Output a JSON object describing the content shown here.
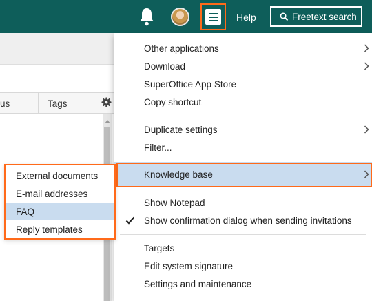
{
  "topbar": {
    "help_label": "Help",
    "search_label": "Freetext search",
    "icons": {
      "notifications": "bell-icon",
      "user": "avatar",
      "menu": "hamburger-menu-icon",
      "search": "search-icon"
    },
    "colors": {
      "bar": "#0e5e5a",
      "highlight": "#ff6a1a"
    }
  },
  "list": {
    "columns": [
      "us",
      "Tags"
    ],
    "settings_icon": "gear-icon"
  },
  "main_menu": {
    "groups": [
      [
        {
          "label": "Other applications",
          "submenu": true
        },
        {
          "label": "Download",
          "submenu": true
        },
        {
          "label": "SuperOffice App Store",
          "submenu": false
        },
        {
          "label": "Copy shortcut",
          "submenu": false
        }
      ],
      [
        {
          "label": "Duplicate settings",
          "submenu": true
        },
        {
          "label": "Filter...",
          "submenu": false
        }
      ],
      [
        {
          "label": "Knowledge base",
          "submenu": true,
          "active": true
        }
      ],
      [
        {
          "label": "Show Notepad",
          "submenu": false
        },
        {
          "label": "Show confirmation dialog when sending invitations",
          "submenu": false,
          "checked": true
        }
      ],
      [
        {
          "label": "Targets",
          "submenu": false
        },
        {
          "label": "Edit system signature",
          "submenu": false
        },
        {
          "label": "Settings and maintenance",
          "submenu": false
        }
      ]
    ],
    "colors": {
      "active_row": "#c9dcef"
    }
  },
  "sub_menu": {
    "items": [
      {
        "label": "External documents"
      },
      {
        "label": "E-mail addresses"
      },
      {
        "label": "FAQ",
        "selected": true
      },
      {
        "label": "Reply templates"
      }
    ]
  }
}
